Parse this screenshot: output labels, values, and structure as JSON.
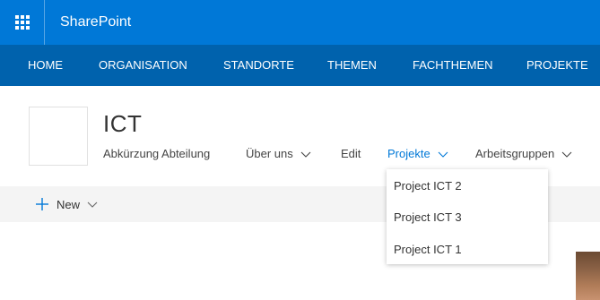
{
  "suitebar": {
    "app_name": "SharePoint",
    "waffle_icon": "waffle-icon"
  },
  "topnav": {
    "items": [
      "HOME",
      "ORGANISATION",
      "STANDORTE",
      "THEMEN",
      "FACHTHEMEN",
      "PROJEKTE"
    ]
  },
  "site": {
    "title": "ICT"
  },
  "sitenav": {
    "items": [
      {
        "label": "Abkürzung Abteilung",
        "dropdown": false
      },
      {
        "label": "Über uns",
        "dropdown": true
      },
      {
        "label": "Edit",
        "dropdown": false
      },
      {
        "label": "Projekte",
        "dropdown": true,
        "active": true
      },
      {
        "label": "Arbeitsgruppen",
        "dropdown": true
      }
    ]
  },
  "commandbar": {
    "new_label": "New"
  },
  "dropdown": {
    "items": [
      "Project ICT 2",
      "Project ICT 3",
      "Project ICT 1"
    ]
  },
  "colors": {
    "suitebar": "#0078d7",
    "topnav": "#0062ad",
    "accent": "#0078d7",
    "commandbar": "#f4f4f4"
  }
}
